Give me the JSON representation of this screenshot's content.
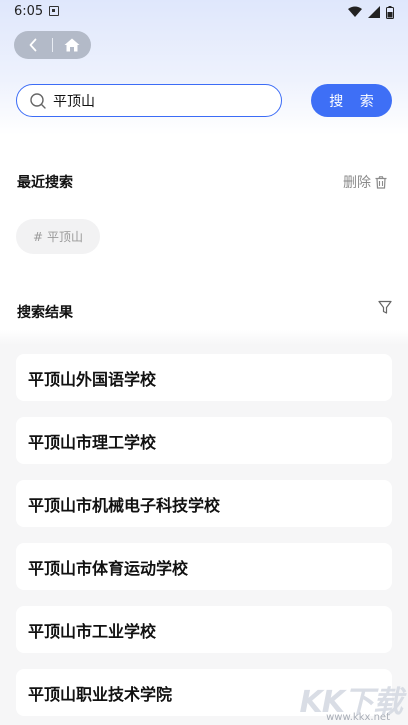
{
  "status_bar": {
    "time": "6:05"
  },
  "nav": {
    "back_icon": "chevron-left-icon",
    "home_icon": "home-icon"
  },
  "search": {
    "value": "平顶山",
    "button_label": "搜 索"
  },
  "recent": {
    "title": "最近搜索",
    "delete_label": "删除",
    "chips": [
      {
        "prefix": "#",
        "label": "平顶山"
      }
    ]
  },
  "results": {
    "title": "搜索结果",
    "items": [
      "平顶山外国语学校",
      "平顶山市理工学校",
      "平顶山市机械电子科技学校",
      "平顶山市体育运动学校",
      "平顶山市工业学校",
      "平顶山职业技术学院"
    ]
  },
  "watermark": {
    "logo": "KK下载",
    "url": "www.kkx.net"
  },
  "colors": {
    "accent": "#3e6ff6",
    "header_gradient_top": "#dfe7fc",
    "list_background": "#f6f6f7"
  }
}
